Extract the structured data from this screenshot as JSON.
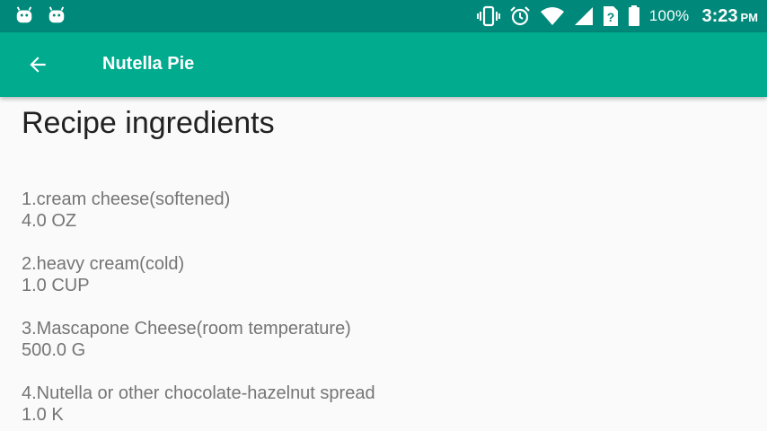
{
  "status_bar": {
    "battery": "100%",
    "time": "3:23",
    "ampm": "PM",
    "icons": [
      "android-icon",
      "android-icon",
      "vibrate-icon",
      "alarm-icon",
      "wifi-icon",
      "signal-icon",
      "no-sim-icon",
      "battery-icon"
    ]
  },
  "app_bar": {
    "title": "Nutella Pie",
    "back_icon": "arrow-back-icon",
    "color": "#00ab8e"
  },
  "content": {
    "heading": "Recipe ingredients",
    "ingredients": [
      {
        "name": "1.cream cheese(softened)",
        "quantity": "4.0 OZ"
      },
      {
        "name": "2.heavy cream(cold)",
        "quantity": "1.0 CUP"
      },
      {
        "name": "3.Mascapone Cheese(room temperature)",
        "quantity": "500.0 G"
      },
      {
        "name": "4.Nutella or other chocolate-hazelnut spread",
        "quantity": "1.0 K"
      }
    ]
  },
  "colors": {
    "status_bar": "#00897b",
    "app_bar": "#00ab8e",
    "background": "#fafafa",
    "heading_text": "#212121",
    "body_text": "#757575"
  }
}
